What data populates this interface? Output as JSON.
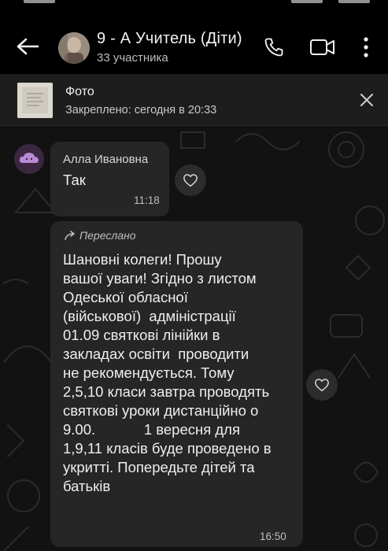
{
  "header": {
    "title": "9 - А Учитель (Діти)",
    "subtitle": "33 участника"
  },
  "pinned": {
    "title": "Фото",
    "subtitle": "Закреплено: сегодня в 20:33"
  },
  "messages": [
    {
      "sender": "Алла Ивановна",
      "text": "Так",
      "time": "11:18"
    },
    {
      "forwarded_label": "Переслано",
      "lines": [
        "Шановні колеги! Прошу",
        "вашої уваги! Згідно з листом",
        "Одеської обласної",
        "(військової)  адміністрації",
        "01.09 святкові лінійки в",
        "закладах освіти  проводити",
        "не рекомендується. Тому",
        "2,5,10 класи завтра проводять",
        "святкові уроки дистанційно о",
        "9.00.            1 вересня для",
        "1,9,11 класів буде проведено в",
        "укритті. Попередьте дітей та",
        "батьків"
      ],
      "time": "16:50"
    }
  ],
  "icons": {
    "back": "arrow-left-icon",
    "call": "phone-icon",
    "video": "video-camera-icon",
    "menu": "more-vertical-icon",
    "close": "close-icon",
    "like": "heart-icon",
    "forward": "forward-arrow-icon"
  }
}
